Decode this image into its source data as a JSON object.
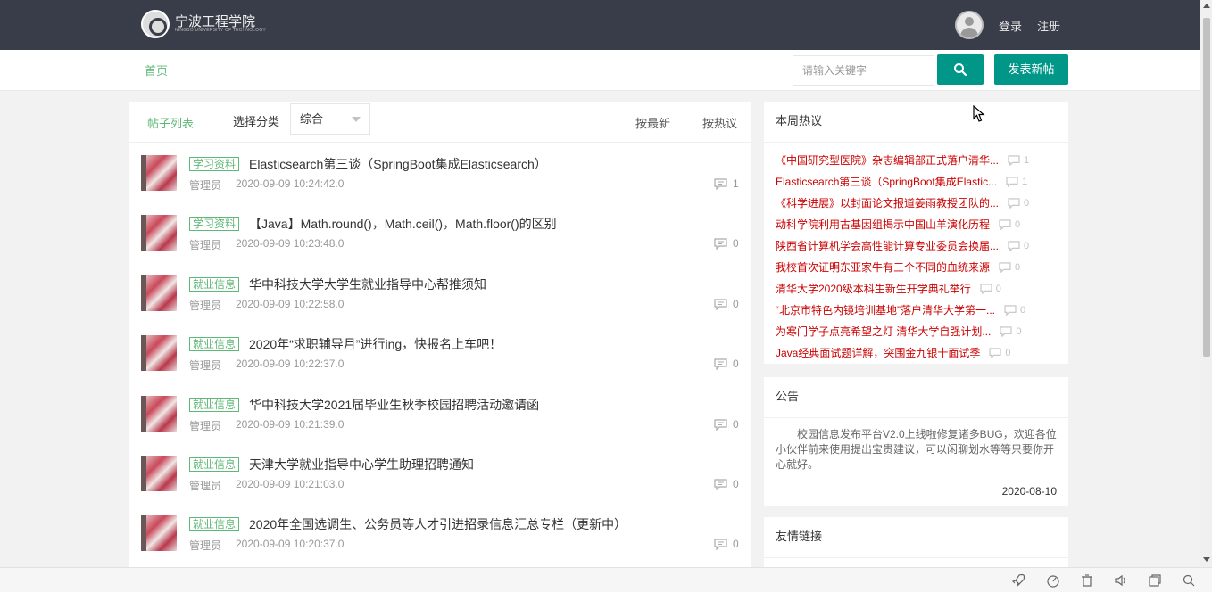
{
  "header": {
    "logo_text": "宁波工程学院",
    "logo_subtext": "NINGBO UNIVERSITY OF TECHNOLOGY",
    "login_label": "登录",
    "register_label": "注册"
  },
  "subnav": {
    "home_label": "首页",
    "search_placeholder": "请输入关键字",
    "post_button_label": "发表新帖"
  },
  "list": {
    "tab_label": "帖子列表",
    "category_label": "选择分类",
    "category_selected": "综合",
    "sort_latest": "按最新",
    "sort_hot": "按热议",
    "posts": [
      {
        "tag": "学习资料",
        "title": "Elasticsearch第三谈（SpringBoot集成Elasticsearch）",
        "author": "管理员",
        "time": "2020-09-09 10:24:42.0",
        "comments": "1"
      },
      {
        "tag": "学习资料",
        "title": "【Java】Math.round()，Math.ceil()，Math.floor()的区别",
        "author": "管理员",
        "time": "2020-09-09 10:23:48.0",
        "comments": "0"
      },
      {
        "tag": "就业信息",
        "title": "华中科技大学大学生就业指导中心帮推须知",
        "author": "管理员",
        "time": "2020-09-09 10:22:58.0",
        "comments": "0"
      },
      {
        "tag": "就业信息",
        "title": "2020年“求职辅导月”进行ing，快报名上车吧！",
        "author": "管理员",
        "time": "2020-09-09 10:22:37.0",
        "comments": "0"
      },
      {
        "tag": "就业信息",
        "title": "华中科技大学2021届毕业生秋季校园招聘活动邀请函",
        "author": "管理员",
        "time": "2020-09-09 10:21:39.0",
        "comments": "0"
      },
      {
        "tag": "就业信息",
        "title": "天津大学就业指导中心学生助理招聘通知",
        "author": "管理员",
        "time": "2020-09-09 10:21:03.0",
        "comments": "0"
      },
      {
        "tag": "就业信息",
        "title": "2020年全国选调生、公务员等人才引进招录信息汇总专栏（更新中）",
        "author": "管理员",
        "time": "2020-09-09 10:20:37.0",
        "comments": "0"
      }
    ]
  },
  "hot": {
    "title": "本周热议",
    "items": [
      {
        "title": "《中国研究型医院》杂志编辑部正式落户清华...",
        "comments": "1"
      },
      {
        "title": "Elasticsearch第三谈（SpringBoot集成Elastic...",
        "comments": "1"
      },
      {
        "title": "《科学进展》以封面论文报道姜雨教授团队的...",
        "comments": "0"
      },
      {
        "title": "动科学院利用古基因组揭示中国山羊演化历程",
        "comments": "0"
      },
      {
        "title": "陕西省计算机学会高性能计算专业委员会换届...",
        "comments": "0"
      },
      {
        "title": "我校首次证明东亚家牛有三个不同的血统来源",
        "comments": "0"
      },
      {
        "title": "清华大学2020级本科生新生开学典礼举行",
        "comments": "0"
      },
      {
        "title": "“北京市特色内镜培训基地”落户清华大学第一...",
        "comments": "0"
      },
      {
        "title": "为寒门学子点亮希望之灯 清华大学自强计划...",
        "comments": "0"
      },
      {
        "title": "Java经典面试题详解，突围金九银十面试季",
        "comments": "0"
      }
    ]
  },
  "notice": {
    "title": "公告",
    "body": "校园信息发布平台V2.0上线啦修复诸多BUG，欢迎各位小伙伴前来使用提出宝贵建议，可以闲聊划水等等只要你开心就好。",
    "date": "2020-08-10"
  },
  "links": {
    "title": "友情链接"
  },
  "colors": {
    "topbar": "#393d49",
    "accent": "#009688",
    "green_text": "#5fb878",
    "hot_red": "#cc0000"
  }
}
